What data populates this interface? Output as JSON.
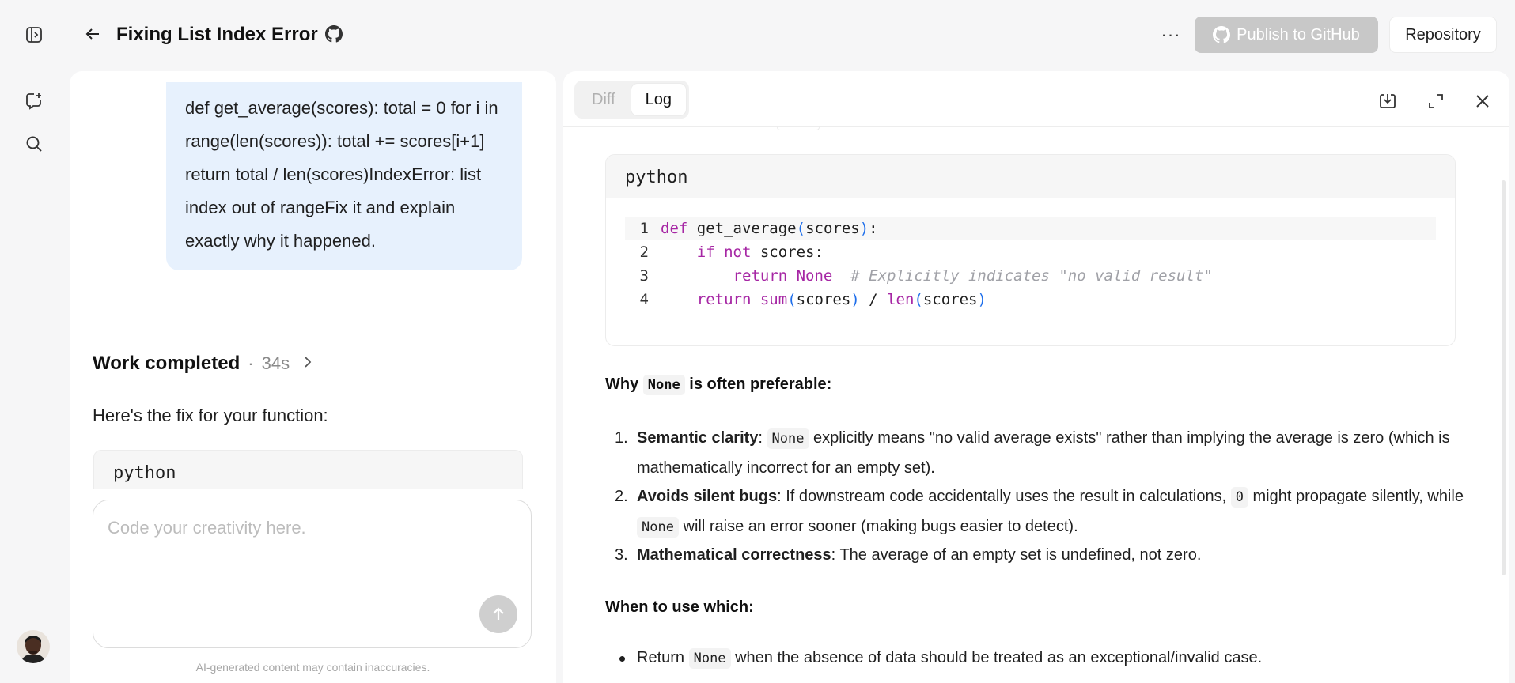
{
  "header": {
    "title": "Fixing List Index Error",
    "title_separator": "·",
    "more_label": "···",
    "publish_label": "Publish to GitHub",
    "repository_label": "Repository"
  },
  "chat": {
    "user_message": "def get_average(scores):    total = 0    for i in range(len(scores)):        total += scores[i+1]    return total / len(scores)IndexError: list index out of rangeFix it and explain exactly why it happened.",
    "work_status": "Work completed",
    "work_separator": "·",
    "work_time": "34s",
    "fix_intro": "Here's the fix for your function:",
    "code_language": "python",
    "input_placeholder": "Code your creativity here.",
    "disclaimer": "AI-generated content may contain inaccuracies."
  },
  "panel": {
    "tabs": [
      {
        "label": "Diff",
        "active": false
      },
      {
        "label": "Log",
        "active": true
      }
    ],
    "code_language": "python",
    "code_lines": [
      {
        "num": "1",
        "indent": "",
        "kw": "def",
        "rest1": " get_average",
        "p1": "(",
        "rest2": "scores",
        "p2": ")",
        "rest3": ":",
        "comment": ""
      },
      {
        "num": "2",
        "indent": "    ",
        "kw": "if not",
        "rest1": " scores:",
        "p1": "",
        "rest2": "",
        "p2": "",
        "rest3": "",
        "comment": ""
      },
      {
        "num": "3",
        "indent": "        ",
        "kw": "return None",
        "rest1": "  ",
        "p1": "",
        "rest2": "",
        "p2": "",
        "rest3": "",
        "comment": "# Explicitly indicates \"no valid result\""
      },
      {
        "num": "4",
        "indent": "    ",
        "kw": "return",
        "rest1": " ",
        "p1": "",
        "rest2": "",
        "p2": "",
        "rest3": "",
        "comment": ""
      }
    ],
    "line4": {
      "sum": "sum",
      "open": "(",
      "arg": "scores",
      "close": ")",
      "div": " / ",
      "len": "len",
      "open2": "(",
      "arg2": "scores",
      "close2": ")"
    },
    "why_heading": {
      "pre": "Why ",
      "code": "None",
      "post": " is often preferable:"
    },
    "reasons": [
      {
        "num": "1.",
        "title": "Semantic clarity",
        "sep": ": ",
        "code": "None",
        "text": " explicitly means \"no valid average exists\" rather than implying the average is zero (which is mathematically incorrect for an empty set)."
      },
      {
        "num": "2.",
        "title": "Avoids silent bugs",
        "sep": ": ",
        "text_a": "If downstream code accidentally uses the result in calculations, ",
        "code_a": "0",
        "text_b": " might propagate silently, while ",
        "code_b": "None",
        "text_c": " will raise an error sooner (making bugs easier to detect)."
      },
      {
        "num": "3.",
        "title": "Mathematical correctness",
        "sep": ": ",
        "text": "The average of an empty set is undefined, not zero."
      }
    ],
    "when_heading": "When to use which:",
    "bullets": [
      {
        "pre": "Return ",
        "code": "None",
        "post": " when the absence of data should be treated as an exceptional/invalid case."
      }
    ]
  }
}
